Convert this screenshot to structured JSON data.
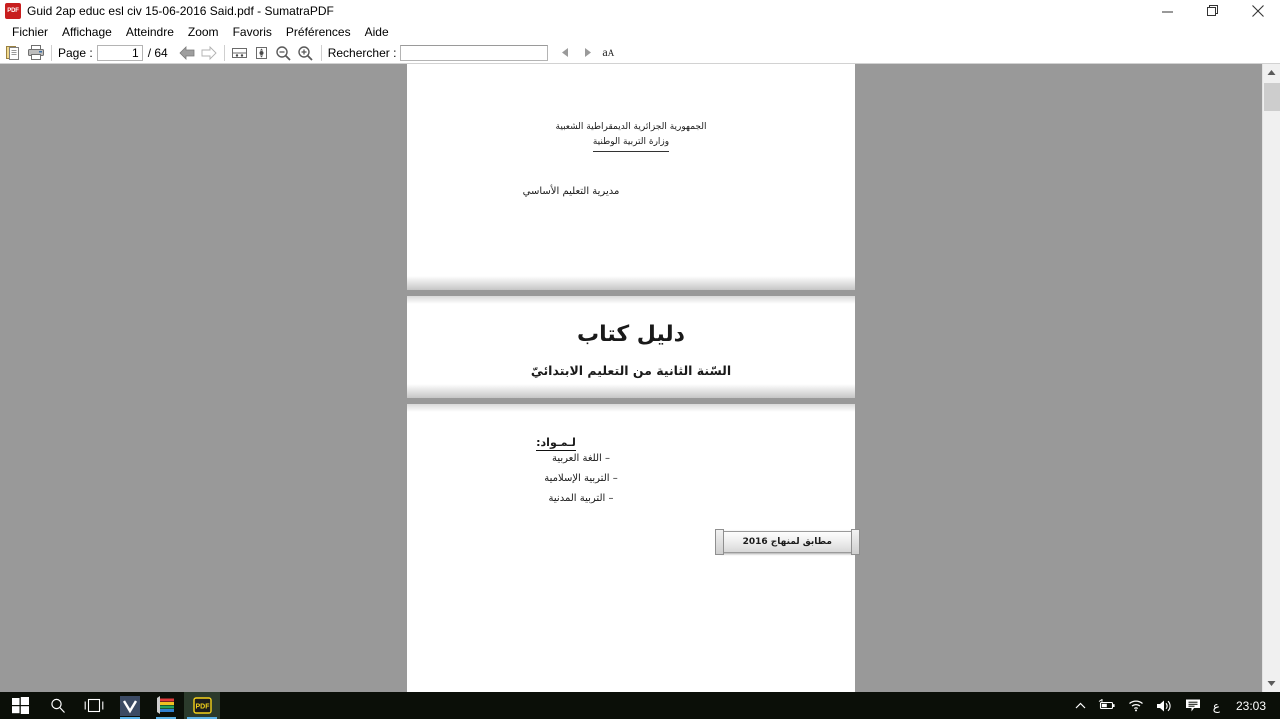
{
  "window": {
    "title": "Guid 2ap educ esl civ 15-06-2016 Said.pdf - SumatraPDF",
    "app_icon_label": "PDF",
    "controls": {
      "minimize": "minimize-icon",
      "restore": "restore-icon",
      "close": "close-icon"
    }
  },
  "menubar": {
    "items": [
      {
        "label": "Fichier"
      },
      {
        "label": "Affichage"
      },
      {
        "label": "Atteindre"
      },
      {
        "label": "Zoom"
      },
      {
        "label": "Favoris"
      },
      {
        "label": "Préférences"
      },
      {
        "label": "Aide"
      }
    ]
  },
  "toolbar": {
    "open_icon": "open-document-icon",
    "print_icon": "print-icon",
    "page_label": "Page :",
    "page_value": "1",
    "page_total": "/ 64",
    "prev_icon": "arrow-left-icon",
    "next_icon": "arrow-right-icon",
    "fit_width_icon": "fit-width-icon",
    "fit_page_icon": "fit-page-icon",
    "zoom_out_icon": "zoom-out-icon",
    "zoom_in_icon": "zoom-in-icon",
    "find_label": "Rechercher :",
    "find_value": "",
    "find_placeholder": "",
    "find_prev_icon": "find-previous-icon",
    "find_next_icon": "find-next-icon",
    "match_case_big": "a",
    "match_case_small": "A"
  },
  "document": {
    "header_line_1": "الجمهورية الجزائرية الديمقراطية الشعبية",
    "header_line_2": "وزارة التربية الوطنية",
    "directorate": "مديرية التعليم الأساسي",
    "title": "دليل كتاب",
    "subtitle": "السّنة الثانية من التعليم الابتدائيّ",
    "subjects_heading": "لـمـواد:",
    "subjects": [
      {
        "label": "– اللغة العربية"
      },
      {
        "label": "– التربية الإسلامية"
      },
      {
        "label": "– التربية المدنية"
      }
    ],
    "stamp": "مطابق لمنهاج 2016"
  },
  "scrollbar": {
    "up_icon": "scroll-up-icon",
    "down_icon": "scroll-down-icon"
  },
  "taskbar": {
    "start_icon": "windows-start-icon",
    "search_icon": "search-icon",
    "task_view_icon": "task-view-icon",
    "apps": [
      {
        "name": "vivaldi-icon",
        "label": "V"
      },
      {
        "name": "winrar-icon",
        "label": ""
      },
      {
        "name": "sumatrapdf-icon",
        "label": "PDF"
      }
    ],
    "tray": {
      "chevron_icon": "chevron-up-icon",
      "battery_icon": "battery-icon",
      "wifi_icon": "wifi-icon",
      "volume_icon": "volume-icon",
      "notifications_icon": "notifications-icon",
      "language": "ع",
      "clock": "23:03"
    }
  },
  "colors": {
    "canvas_gray": "#999999",
    "page_white": "#ffffff",
    "taskbar": "#0b0f08",
    "accent_blue": "#5bb2e8",
    "pdf_red": "#c81e1e"
  }
}
